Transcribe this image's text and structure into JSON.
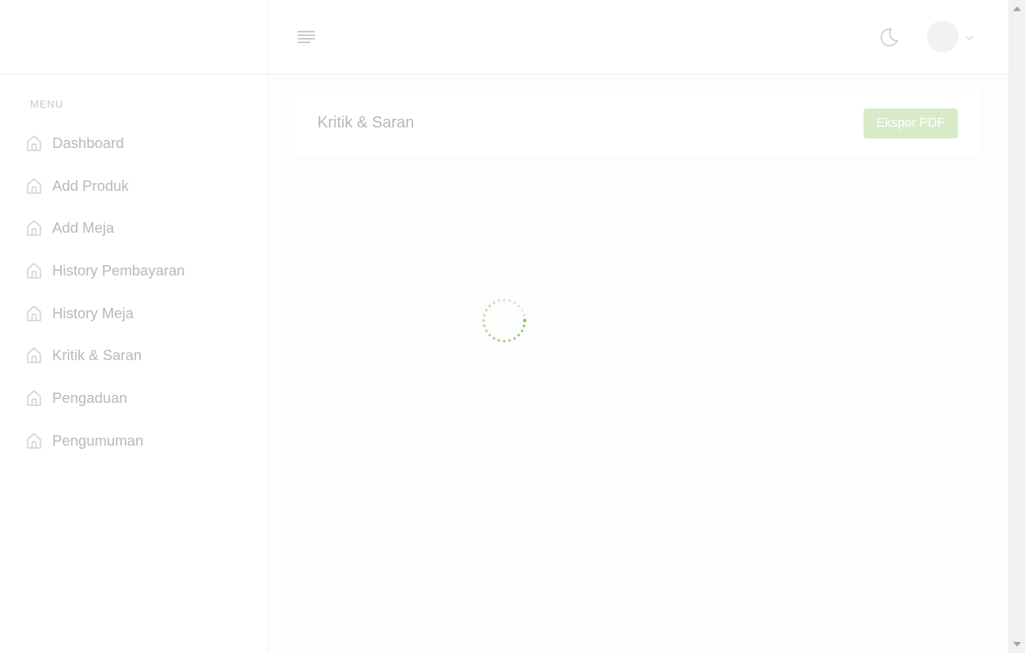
{
  "sidebar": {
    "menu_title": "MENU",
    "items": [
      {
        "label": "Dashboard",
        "icon": "home-icon"
      },
      {
        "label": "Add Produk",
        "icon": "home-icon"
      },
      {
        "label": "Add Meja",
        "icon": "home-icon"
      },
      {
        "label": "History Pembayaran",
        "icon": "home-icon"
      },
      {
        "label": "History Meja",
        "icon": "home-icon"
      },
      {
        "label": "Kritik & Saran",
        "icon": "home-icon"
      },
      {
        "label": "Pengaduan",
        "icon": "home-icon"
      },
      {
        "label": "Pengumuman",
        "icon": "home-icon"
      }
    ]
  },
  "header": {
    "icons": [
      "hamburger-icon",
      "moon-icon",
      "avatar",
      "chevron-down-icon"
    ]
  },
  "main": {
    "page_title": "Kritik & Saran",
    "export_button": "Ekspor PDF",
    "loading": true
  },
  "colors": {
    "accent": "#8cc063",
    "button_bg": "#d8ebc9",
    "text_muted": "#b5b9be"
  }
}
